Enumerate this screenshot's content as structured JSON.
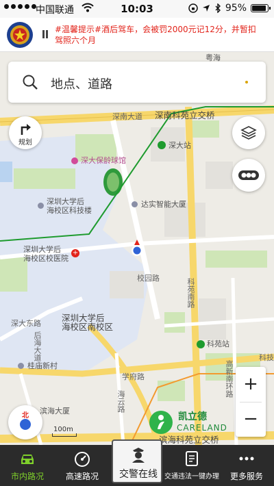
{
  "status_bar": {
    "carrier": "中国联通",
    "time": "10:03",
    "battery": "95%"
  },
  "notice": {
    "text": "#温馨提示#酒后驾车，会被罚2000元记12分，并暂扣驾照六个月"
  },
  "search": {
    "placeholder": "地点、道路"
  },
  "map_buttons": {
    "route_label": "规划",
    "compass_label": "北",
    "scale_label": "100m"
  },
  "map_labels": {
    "shennan_road": "深南大道",
    "shennan_interchange": "深南科苑立交桥",
    "shenda_station": "深大站",
    "stadium": "深大保龄球馆",
    "pku_sz": "深圳大学后\n海校区科技楼",
    "dashi_building": "达实智能大厦",
    "hospital": "深圳大学后\n海校区校医院",
    "pku_south": "深圳大学后\n海校区南校区",
    "shenda_east": "深大东路",
    "xiaoyuan_road": "校园路",
    "keyuan_south": "科苑南路",
    "keyuan_station": "科苑站",
    "guimiao": "桂庙新村",
    "xuefu_road": "学府路",
    "binhai_building": "滨海大厦",
    "haiyun_road": "海云路",
    "binhai_interchange": "滨海科苑立交桥",
    "gaoxin_south": "高新南环路",
    "houhai_road": "后海大道",
    "ke_partial": "科",
    "tech": "科技",
    "yuefa": "粤海"
  },
  "brand": {
    "cn": "凯立德",
    "en": "CARELAND"
  },
  "tabs": [
    {
      "label": "市内路况",
      "icon": "car-icon",
      "active": true
    },
    {
      "label": "高速路况",
      "icon": "speedometer-icon",
      "active": false
    },
    {
      "label": "交警在线",
      "icon": "police-icon",
      "active": false
    },
    {
      "label": "交通违法一键办理",
      "icon": "document-icon",
      "active": false
    },
    {
      "label": "更多服务",
      "icon": "more-icon",
      "active": false
    }
  ],
  "colors": {
    "accent_green": "#7fd02b",
    "notice_red": "#e2231a",
    "road_yellow": "#f7d76b",
    "metro_green": "#1e9b2e"
  }
}
